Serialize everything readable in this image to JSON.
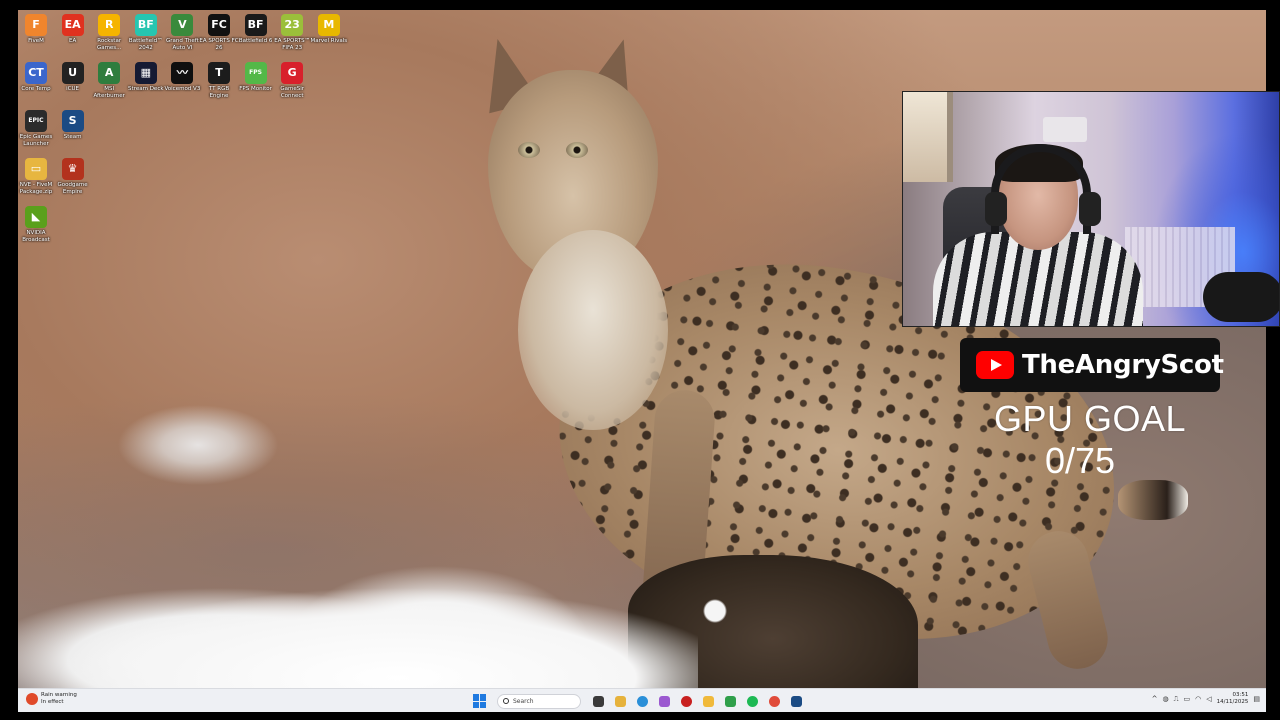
{
  "desktop": {
    "icons": [
      {
        "label": "FiveM",
        "glyph": "F",
        "color": "#f0852d",
        "icon": "fivem-icon"
      },
      {
        "label": "EA",
        "glyph": "EA",
        "color": "#e0321f",
        "icon": "ea-icon"
      },
      {
        "label": "Rockstar Games...",
        "glyph": "R",
        "color": "#f5b400",
        "icon": "rockstar-icon"
      },
      {
        "label": "Battlefield™ 2042",
        "glyph": "BF",
        "color": "#26c6b0",
        "icon": "battlefield-2042-icon"
      },
      {
        "label": "Grand Theft Auto VI",
        "glyph": "V",
        "color": "#3a8a3c",
        "icon": "gta-icon"
      },
      {
        "label": "EA SPORTS FC 26",
        "glyph": "FC",
        "color": "#111111",
        "icon": "ea-fc-icon"
      },
      {
        "label": "Battlefield 6",
        "glyph": "BF",
        "color": "#1a1a1a",
        "icon": "battlefield-6-icon"
      },
      {
        "label": "EA SPORTS™ FIFA 23",
        "glyph": "23",
        "color": "#9bbf3a",
        "icon": "fifa-icon"
      },
      {
        "label": "Marvel Rivals",
        "glyph": "M",
        "color": "#e8b800",
        "icon": "marvel-rivals-icon"
      },
      {
        "label": "Core Temp",
        "glyph": "CT",
        "color": "#3a66cc",
        "icon": "core-temp-icon"
      },
      {
        "label": "iCUE",
        "glyph": "U",
        "color": "#222222",
        "icon": "icue-icon"
      },
      {
        "label": "MSI Afterburner",
        "glyph": "A",
        "color": "#2f7d3e",
        "icon": "msi-afterburner-icon"
      },
      {
        "label": "Stream Deck",
        "glyph": "▦",
        "color": "#151a33",
        "icon": "stream-deck-icon"
      },
      {
        "label": "Voicemod V3",
        "glyph": "〰",
        "color": "#0f0f0f",
        "icon": "voicemod-icon"
      },
      {
        "label": "TT RGB Engine",
        "glyph": "T",
        "color": "#1c1c1c",
        "icon": "tt-rgb-icon"
      },
      {
        "label": "FPS Monitor",
        "glyph": "FPS",
        "color": "#53b848",
        "icon": "fps-monitor-icon"
      },
      {
        "label": "GameSir Connect",
        "glyph": "G",
        "color": "#d8202b",
        "icon": "gamesir-icon"
      },
      {
        "label": "Epic Games Launcher",
        "glyph": "EPIC",
        "color": "#2b2b2b",
        "icon": "epic-games-icon"
      },
      {
        "label": "Steam",
        "glyph": "S",
        "color": "#1b4b84",
        "icon": "steam-icon"
      },
      {
        "label": "NVE - FiveM Package.zip",
        "glyph": "▭",
        "color": "#e7b640",
        "icon": "zip-folder-icon"
      },
      {
        "label": "Goodgame Empire",
        "glyph": "♛",
        "color": "#b3321d",
        "icon": "goodgame-empire-icon"
      },
      {
        "label": "NVIDIA Broadcast",
        "glyph": "◣",
        "color": "#5aa01c",
        "icon": "nvidia-broadcast-icon"
      }
    ]
  },
  "overlay": {
    "channel_name": "TheAngryScot",
    "goal_title": "GPU GOAL",
    "goal_count": "0/75"
  },
  "taskbar": {
    "weather_line1": "Rain warning",
    "weather_line2": "In effect",
    "search_placeholder": "Search",
    "apps": [
      {
        "icon": "task-view-icon",
        "color": "#3a3a3a"
      },
      {
        "icon": "file-explorer-icon",
        "color": "#e6b23c"
      },
      {
        "icon": "edge-icon",
        "color": "#2a8fd8"
      },
      {
        "icon": "copilot-icon",
        "color": "#9b59d0"
      },
      {
        "icon": "obs-record-icon",
        "color": "#c82020"
      },
      {
        "icon": "folder-icon",
        "color": "#f0b93a"
      },
      {
        "icon": "xbox-icon",
        "color": "#2f9f4a"
      },
      {
        "icon": "spotify-icon",
        "color": "#1db954"
      },
      {
        "icon": "chrome-icon",
        "color": "#e04b3a"
      },
      {
        "icon": "steam-taskbar-icon",
        "color": "#1b4b84"
      }
    ],
    "clock_time": "03:51",
    "clock_date": "14/11/2025"
  }
}
